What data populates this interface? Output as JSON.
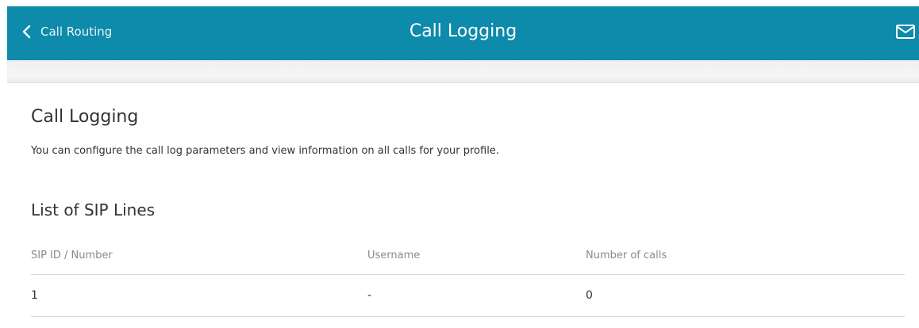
{
  "header": {
    "back_label": "Call Routing",
    "title": "Call Logging",
    "colors": {
      "bar": "#0e8aab",
      "text": "#ffffff"
    }
  },
  "main": {
    "title": "Call Logging",
    "description": "You can configure the call log parameters and view information on all calls for your profile.",
    "sip_lines": {
      "title": "List of SIP Lines",
      "columns": [
        "SIP ID / Number",
        "Username",
        "Number of calls"
      ],
      "rows": [
        [
          "1",
          "-",
          "0"
        ]
      ]
    }
  },
  "icons": {
    "back": "chevron-left-icon",
    "mail": "envelope-icon"
  }
}
